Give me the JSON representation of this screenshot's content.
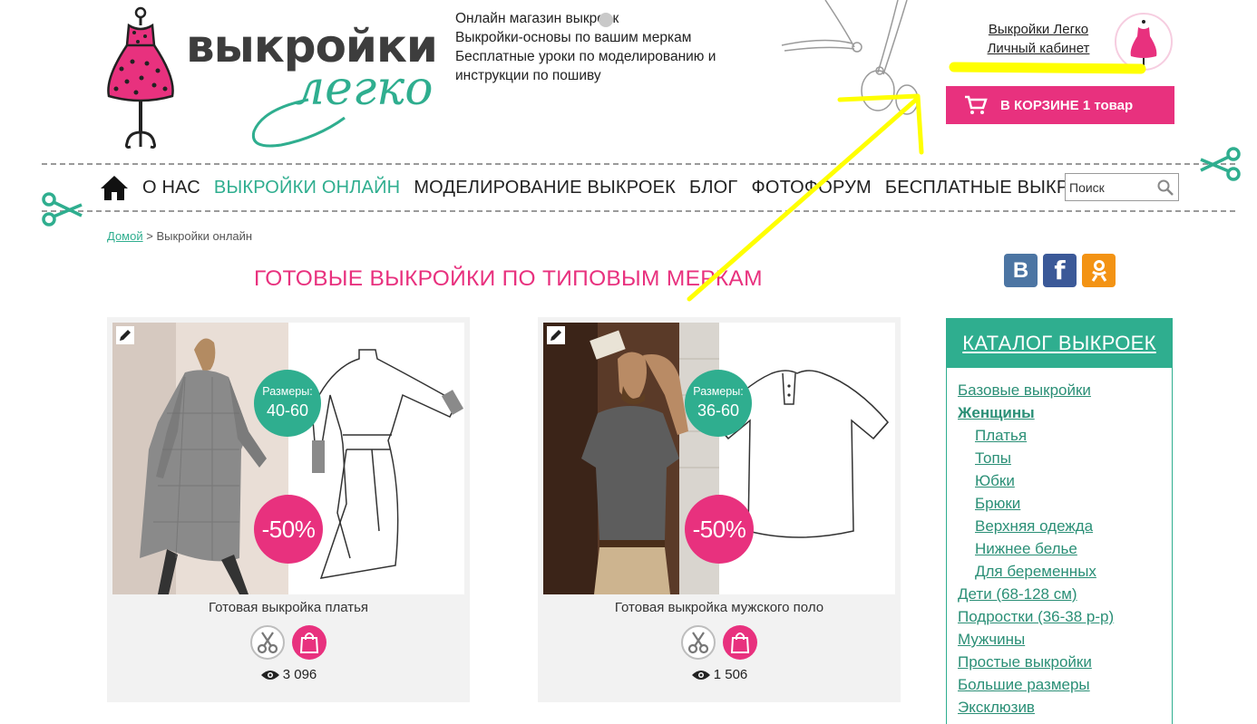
{
  "header": {
    "logo_line1": "выкройки",
    "logo_line2": "легко",
    "tagline": [
      "Онлайн магазин выкроек",
      "Выкройки-основы по вашим меркам",
      "Бесплатные уроки по моделированию и",
      "инструкции по пошиву"
    ],
    "top_links": [
      "Выкройки Легко",
      "Личный кабинет"
    ],
    "cart_label": "В КОРЗИНЕ 1 товар"
  },
  "nav": {
    "items": [
      "О НАС",
      "ВЫКРОЙКИ ОНЛАЙН",
      "МОДЕЛИРОВАНИЕ ВЫКРОЕК",
      "БЛОГ",
      "ФОТОФОРУМ",
      "БЕСПЛАТНЫЕ ВЫКРОЙКИ"
    ],
    "active_index": 1,
    "search_placeholder": "Поиск"
  },
  "breadcrumb": {
    "home": "Домой",
    "separator": ">",
    "current": "Выкройки онлайн"
  },
  "page_title": "ГОТОВЫЕ ВЫКРОЙКИ ПО ТИПОВЫМ МЕРКАМ",
  "social": {
    "vk": "В",
    "fb": "f",
    "ok": "ок"
  },
  "products": [
    {
      "title": "Готовая выкройка платья",
      "size_label": "Размеры:",
      "sizes": "40-60",
      "discount": "-50%",
      "views": "3 096"
    },
    {
      "title": "Готовая выкройка мужского поло",
      "size_label": "Размеры:",
      "sizes": "36-60",
      "discount": "-50%",
      "views": "1 506"
    }
  ],
  "catalog": {
    "title": "КАТАЛОГ ВЫКРОЕК",
    "items": [
      {
        "label": "Базовые выкройки",
        "level": 0,
        "bold": false
      },
      {
        "label": "Женщины",
        "level": 0,
        "bold": true
      },
      {
        "label": "Платья",
        "level": 1,
        "bold": false
      },
      {
        "label": "Топы",
        "level": 1,
        "bold": false
      },
      {
        "label": "Юбки",
        "level": 1,
        "bold": false
      },
      {
        "label": "Брюки",
        "level": 1,
        "bold": false
      },
      {
        "label": "Верхняя одежда",
        "level": 1,
        "bold": false
      },
      {
        "label": "Нижнее белье",
        "level": 1,
        "bold": false
      },
      {
        "label": "Для беременных",
        "level": 1,
        "bold": false
      },
      {
        "label": "Дети (68-128 см)",
        "level": 0,
        "bold": false
      },
      {
        "label": "Подростки (36-38 р-р)",
        "level": 0,
        "bold": false
      },
      {
        "label": "Мужчины",
        "level": 0,
        "bold": false
      },
      {
        "label": "Простые выкройки",
        "level": 0,
        "bold": false
      },
      {
        "label": "Большие размеры",
        "level": 0,
        "bold": false
      },
      {
        "label": "Эксклюзив",
        "level": 0,
        "bold": false
      }
    ]
  },
  "colors": {
    "brand_pink": "#e8317e",
    "brand_teal": "#2fae8f",
    "annotation_yellow": "#ffff00"
  },
  "icons": [
    "home-icon",
    "search-icon",
    "cart-icon",
    "scissors-icon",
    "shopping-bag-icon",
    "eye-icon",
    "edit-pencil-icon"
  ]
}
